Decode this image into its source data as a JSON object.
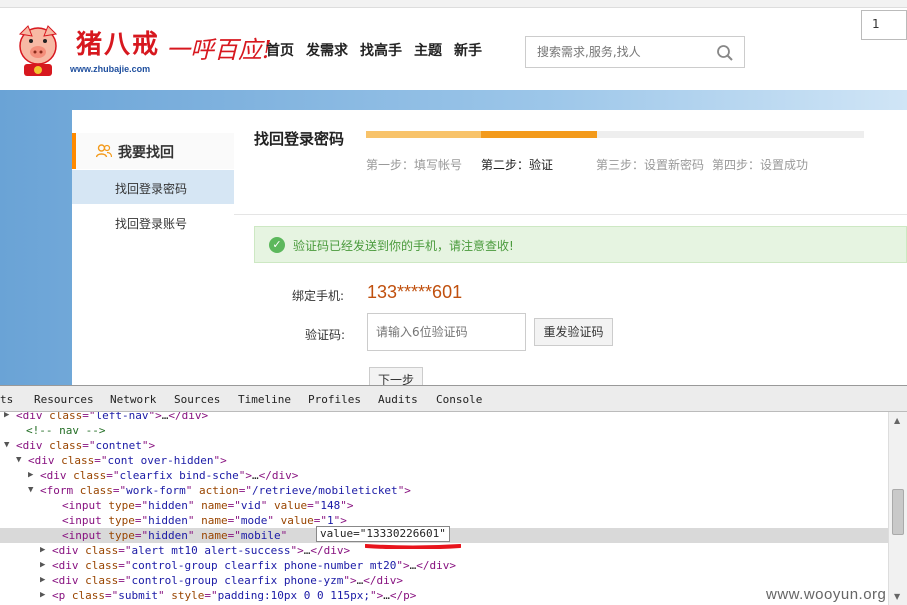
{
  "browser": {
    "page_number": "1"
  },
  "header": {
    "logo_text": "猪八戒",
    "logo_url": "www.zhubajie.com",
    "slogan": "一呼百应!",
    "nav": [
      "首页",
      "发需求",
      "找高手",
      "主题",
      "新手"
    ],
    "search_placeholder": "搜索需求,服务,找人"
  },
  "sidebar": {
    "heading": "我要找回",
    "items": [
      "找回登录密码",
      "找回登录账号"
    ]
  },
  "main": {
    "title": "找回登录密码",
    "progress_steps_done": 2,
    "progress_steps_total": 4,
    "steps": [
      "第一步：填写帐号",
      "第二步：验证",
      "第三步：设置新密码",
      "第四步：设置成功"
    ],
    "current_step": 1,
    "alert": "验证码已经发送到你的手机，请注意查收!",
    "phone_label": "绑定手机:",
    "phone_value": "133*****601",
    "code_label": "验证码:",
    "code_placeholder": "请输入6位验证码",
    "resend_label": "重发验证码",
    "next_label": "下一步"
  },
  "devtools": {
    "tabs": [
      "ts",
      "Resources",
      "Network",
      "Sources",
      "Timeline",
      "Profiles",
      "Audits",
      "Console"
    ],
    "lines": [
      {
        "tri": "▶",
        "parts": [
          [
            "tag",
            "<div "
          ],
          [
            "attr",
            "class"
          ],
          [
            "tag",
            "=\""
          ],
          [
            "val",
            "left-nav"
          ],
          [
            "tag",
            "\">"
          ],
          [
            "txt",
            "…"
          ],
          [
            "tag",
            "</div>"
          ]
        ]
      },
      {
        "tri": "",
        "parts": [
          [
            "cmt",
            "<!-- nav -->"
          ]
        ]
      },
      {
        "tri": "▼",
        "parts": [
          [
            "tag",
            "<div "
          ],
          [
            "attr",
            "class"
          ],
          [
            "tag",
            "=\""
          ],
          [
            "val",
            "contnet"
          ],
          [
            "tag",
            "\">"
          ]
        ]
      },
      {
        "tri": "▼",
        "parts": [
          [
            "tag",
            "<div "
          ],
          [
            "attr",
            "class"
          ],
          [
            "tag",
            "=\""
          ],
          [
            "val",
            "cont over-hidden"
          ],
          [
            "tag",
            "\">"
          ]
        ]
      },
      {
        "tri": "▶",
        "parts": [
          [
            "tag",
            "<div "
          ],
          [
            "attr",
            "class"
          ],
          [
            "tag",
            "=\""
          ],
          [
            "val",
            "clearfix bind-sche"
          ],
          [
            "tag",
            "\">"
          ],
          [
            "txt",
            "…"
          ],
          [
            "tag",
            "</div>"
          ]
        ]
      },
      {
        "tri": "▼",
        "parts": [
          [
            "tag",
            "<form "
          ],
          [
            "attr",
            "class"
          ],
          [
            "tag",
            "=\""
          ],
          [
            "val",
            "work-form"
          ],
          [
            "tag",
            "\" "
          ],
          [
            "attr",
            "action"
          ],
          [
            "tag",
            "=\""
          ],
          [
            "val",
            "/retrieve/mobileticket"
          ],
          [
            "tag",
            "\">"
          ]
        ]
      },
      {
        "tri": "",
        "parts": [
          [
            "tag",
            "<input "
          ],
          [
            "attr",
            "type"
          ],
          [
            "tag",
            "=\""
          ],
          [
            "val",
            "hidden"
          ],
          [
            "tag",
            "\" "
          ],
          [
            "attr",
            "name"
          ],
          [
            "tag",
            "=\""
          ],
          [
            "val",
            "vid"
          ],
          [
            "tag",
            "\" "
          ],
          [
            "attr",
            "value"
          ],
          [
            "tag",
            "=\""
          ],
          [
            "val",
            "148"
          ],
          [
            "tag",
            "\">"
          ]
        ]
      },
      {
        "tri": "",
        "parts": [
          [
            "tag",
            "<input "
          ],
          [
            "attr",
            "type"
          ],
          [
            "tag",
            "=\""
          ],
          [
            "val",
            "hidden"
          ],
          [
            "tag",
            "\" "
          ],
          [
            "attr",
            "name"
          ],
          [
            "tag",
            "=\""
          ],
          [
            "val",
            "mode"
          ],
          [
            "tag",
            "\" "
          ],
          [
            "attr",
            "value"
          ],
          [
            "tag",
            "=\""
          ],
          [
            "val",
            "1"
          ],
          [
            "tag",
            "\">"
          ]
        ]
      },
      {
        "tri": "",
        "parts": [
          [
            "tag",
            "<input "
          ],
          [
            "attr",
            "type"
          ],
          [
            "tag",
            "=\""
          ],
          [
            "val",
            "hidden"
          ],
          [
            "tag",
            "\" "
          ],
          [
            "attr",
            "name"
          ],
          [
            "tag",
            "=\""
          ],
          [
            "val",
            "mobile"
          ],
          [
            "tag",
            "\""
          ]
        ]
      },
      {
        "tri": "▶",
        "parts": [
          [
            "tag",
            "<div "
          ],
          [
            "attr",
            "class"
          ],
          [
            "tag",
            "=\""
          ],
          [
            "val",
            "alert mt10 alert-success"
          ],
          [
            "tag",
            "\">"
          ],
          [
            "txt",
            "…"
          ],
          [
            "tag",
            "</div>"
          ]
        ]
      },
      {
        "tri": "▶",
        "parts": [
          [
            "tag",
            "<div "
          ],
          [
            "attr",
            "class"
          ],
          [
            "tag",
            "=\""
          ],
          [
            "val",
            "control-group clearfix phone-number mt20"
          ],
          [
            "tag",
            "\">"
          ],
          [
            "txt",
            "…"
          ],
          [
            "tag",
            "</div>"
          ]
        ]
      },
      {
        "tri": "▶",
        "parts": [
          [
            "tag",
            "<div "
          ],
          [
            "attr",
            "class"
          ],
          [
            "tag",
            "=\""
          ],
          [
            "val",
            "control-group clearfix phone-yzm"
          ],
          [
            "tag",
            "\">"
          ],
          [
            "txt",
            "…"
          ],
          [
            "tag",
            "</div>"
          ]
        ]
      },
      {
        "tri": "▶",
        "parts": [
          [
            "tag",
            "<p "
          ],
          [
            "attr",
            "class"
          ],
          [
            "tag",
            "=\""
          ],
          [
            "val",
            "submit"
          ],
          [
            "tag",
            "\" "
          ],
          [
            "attr",
            "style"
          ],
          [
            "tag",
            "=\""
          ],
          [
            "val",
            "padding:10px 0 0 115px;"
          ],
          [
            "tag",
            "\">"
          ],
          [
            "txt",
            "…"
          ],
          [
            "tag",
            "</p>"
          ]
        ]
      }
    ],
    "tooltip": "value=\"13330226601\""
  },
  "watermark": "www.wooyun.org",
  "colors": {
    "brand_red": "#d7181f",
    "accent_orange": "#f39a1b",
    "progress_light": "#f8c36a",
    "phone_color": "#c0500e",
    "success_green": "#5cb85c"
  }
}
